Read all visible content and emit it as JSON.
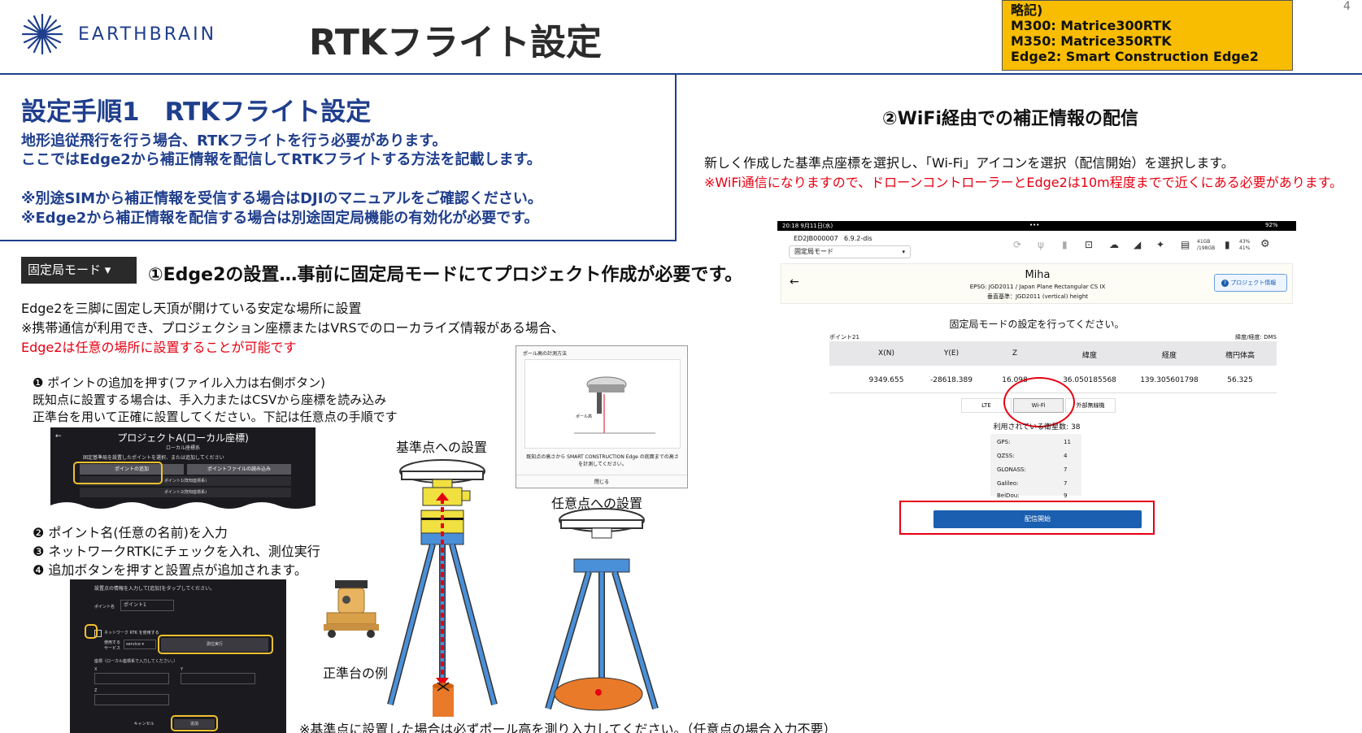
{
  "header": {
    "logo_text": "EARTHBRAIN",
    "title": "RTKフライト設定",
    "page_number": "4",
    "legend_lines": [
      "略記)",
      "M300: Matrice300RTK",
      "M350: Matrice350RTK",
      "Edge2: Smart Construction Edge2"
    ]
  },
  "step": {
    "title": "設定手順1　RTKフライト設定",
    "lines": [
      "地形追従飛行を行う場合、RTKフライトを行う必要があります。",
      "ここではEdge2から補正情報を配信してRTKフライトする方法を記載します。",
      "※別途SIMから補正情報を受信する場合はDJIのマニュアルをご確認ください。",
      "※Edge2から補正情報を配信する場合は別途固定局機能の有効化が必要です。"
    ]
  },
  "section1": {
    "mode_badge": "固定局モード ▾",
    "title": "①Edge2の設置…事前に固定局モードにてプロジェクト作成が必要です。",
    "line1": "Edge2を三脚に固定し天頂が開けている安定な場所に設置",
    "line2": "※携帯通信が利用でき、プロジェクション座標またはVRSでのローカライズ情報がある場合、",
    "line3_red": "Edge2は任意の場所に設置することが可能です",
    "instr1": "❶ ポイントの追加を押す(ファイル入力は右側ボタン)",
    "instr2": "既知点に設置する場合は、手入力またはCSVから座標を読み込み",
    "instr3": "正準台を用いて正確に設置してください。下記は任意点の手順です",
    "instr4": "❷ ポイント名(任意の名前)を入力",
    "instr5": "❸ ネットワークRTKにチェックを入れ、測位実行",
    "instr6": "❹ 追加ボタンを押すと設置点が追加されます。",
    "label_reference": "基準点への設置",
    "label_arbitrary": "任意点への設置",
    "label_tribrach": "正準台の例",
    "footnote": "※基準点に設置した場合は必ずポール高を測り入力してください。（任意点の場合入力不要）"
  },
  "shot1": {
    "back": "←",
    "title": "プロジェクトA(ローカル座標)",
    "subtitle": "ローカル座標系",
    "prompt": "固定基準局を設置したポイントを選択、または追加してください",
    "btn_add": "ポイントの追加",
    "btn_file": "ポイントファイルの読み込み",
    "row1": "ポイント1(既知座標系)",
    "row2": "ポイント2(既知座標系)"
  },
  "shot2": {
    "prompt": "設置点の情報を入力して[追加]をタップしてください。",
    "name_label": "ポイント名",
    "name_value": "ポイント1",
    "nrtk_label": "ネットワーク RTK を使用する",
    "service_label": "使用する サービス",
    "service_value": "service ▾",
    "measure_btn": "測位実行",
    "coord_label": "座標（ローカル座標系で入力してください。）",
    "x": "X",
    "y": "Y",
    "z": "Z",
    "cancel": "キャンセル",
    "add": "追加"
  },
  "pole": {
    "title": "ポール高の計測方法",
    "pole_label": "ポール高",
    "desc": "既知点の高さから SMART CONSTRUCTION Edge の底面までの高さを計測してください。",
    "close": "閉じる"
  },
  "section2": {
    "title": "②WiFi経由での補正情報の配信",
    "line1": "新しく作成した基準点座標を選択し、「Wi-Fi」アイコンを選択（配信開始）を選択します。",
    "line2_red": "※WiFi通信になりますので、ドローンコントローラーとEdge2は10m程度までで近くにある必要があります。"
  },
  "tablet": {
    "status_time": "20:18  9月11日(水)",
    "status_dots": "•••",
    "status_battery": "92%",
    "device_id": "ED2JB000007",
    "version": "6.9.2-dis",
    "mode": "固定局モード",
    "storage": "41GB\n/198GB",
    "percents": "43%\n41%",
    "project_name": "Miha",
    "epsg": "EPSG: JGD2011 / Japan Plane Rectangular CS IX",
    "vertical": "垂直基準：JGD2011 (vertical) height",
    "project_info_btn": "プロジェクト情報",
    "prompt": "固定局モードの設定を行ってください。",
    "point_name": "ポイント21",
    "latlon_format": "緯度/経度: DMS",
    "headers": [
      "X(N)",
      "Y(E)",
      "Z",
      "緯度",
      "経度",
      "楕円体高"
    ],
    "values": [
      "9349.655",
      "-28618.389",
      "16.098",
      "36.050185568",
      "139.305601798",
      "56.325"
    ],
    "tabs": [
      "LTE",
      "Wi-Fi",
      "外部無線機"
    ],
    "satellites_label": "利用されている衛星数: 38",
    "satellites": [
      {
        "name": "GPS:",
        "count": "11"
      },
      {
        "name": "QZSS:",
        "count": "4"
      },
      {
        "name": "GLONASS:",
        "count": "7"
      },
      {
        "name": "Galileo:",
        "count": "7"
      },
      {
        "name": "BeiDou:",
        "count": "9"
      }
    ],
    "start_button": "配信開始"
  },
  "colors": {
    "brand_blue": "#1f3e8c",
    "highlight_red": "#e60012",
    "legend_yellow": "#f8bd00",
    "tablet_button_blue": "#1a5fb0"
  }
}
